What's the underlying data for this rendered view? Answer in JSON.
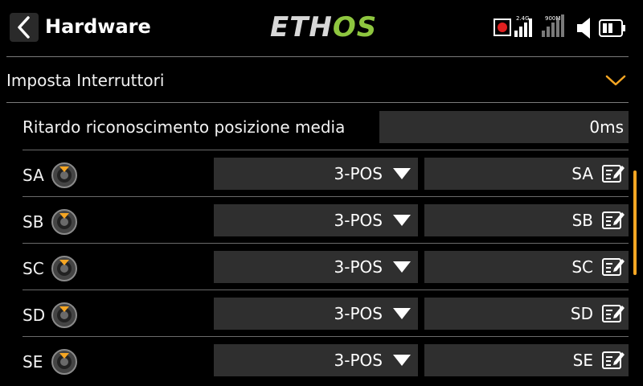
{
  "header": {
    "title": "Hardware",
    "logo_left": "ETH",
    "logo_right": "OS",
    "status": {
      "band1": "2.4G",
      "band2": "900M",
      "icons": [
        "record-icon",
        "signal-bars-icon",
        "signal-bars-icon",
        "speaker-icon",
        "battery-icon"
      ]
    }
  },
  "section": {
    "label": "Imposta Interruttori",
    "expanded": true
  },
  "delay": {
    "label": "Ritardo riconoscimento posizione media",
    "value": "0ms"
  },
  "switches": [
    {
      "name": "SA",
      "type": "3-POS",
      "alias": "SA"
    },
    {
      "name": "SB",
      "type": "3-POS",
      "alias": "SB"
    },
    {
      "name": "SC",
      "type": "3-POS",
      "alias": "SC"
    },
    {
      "name": "SD",
      "type": "3-POS",
      "alias": "SD"
    },
    {
      "name": "SE",
      "type": "3-POS",
      "alias": "SE"
    }
  ],
  "colors": {
    "accent": "#f5a623",
    "logo_green": "#8ec63f",
    "field_bg": "#2f2f2f",
    "record_red": "#e02020"
  }
}
